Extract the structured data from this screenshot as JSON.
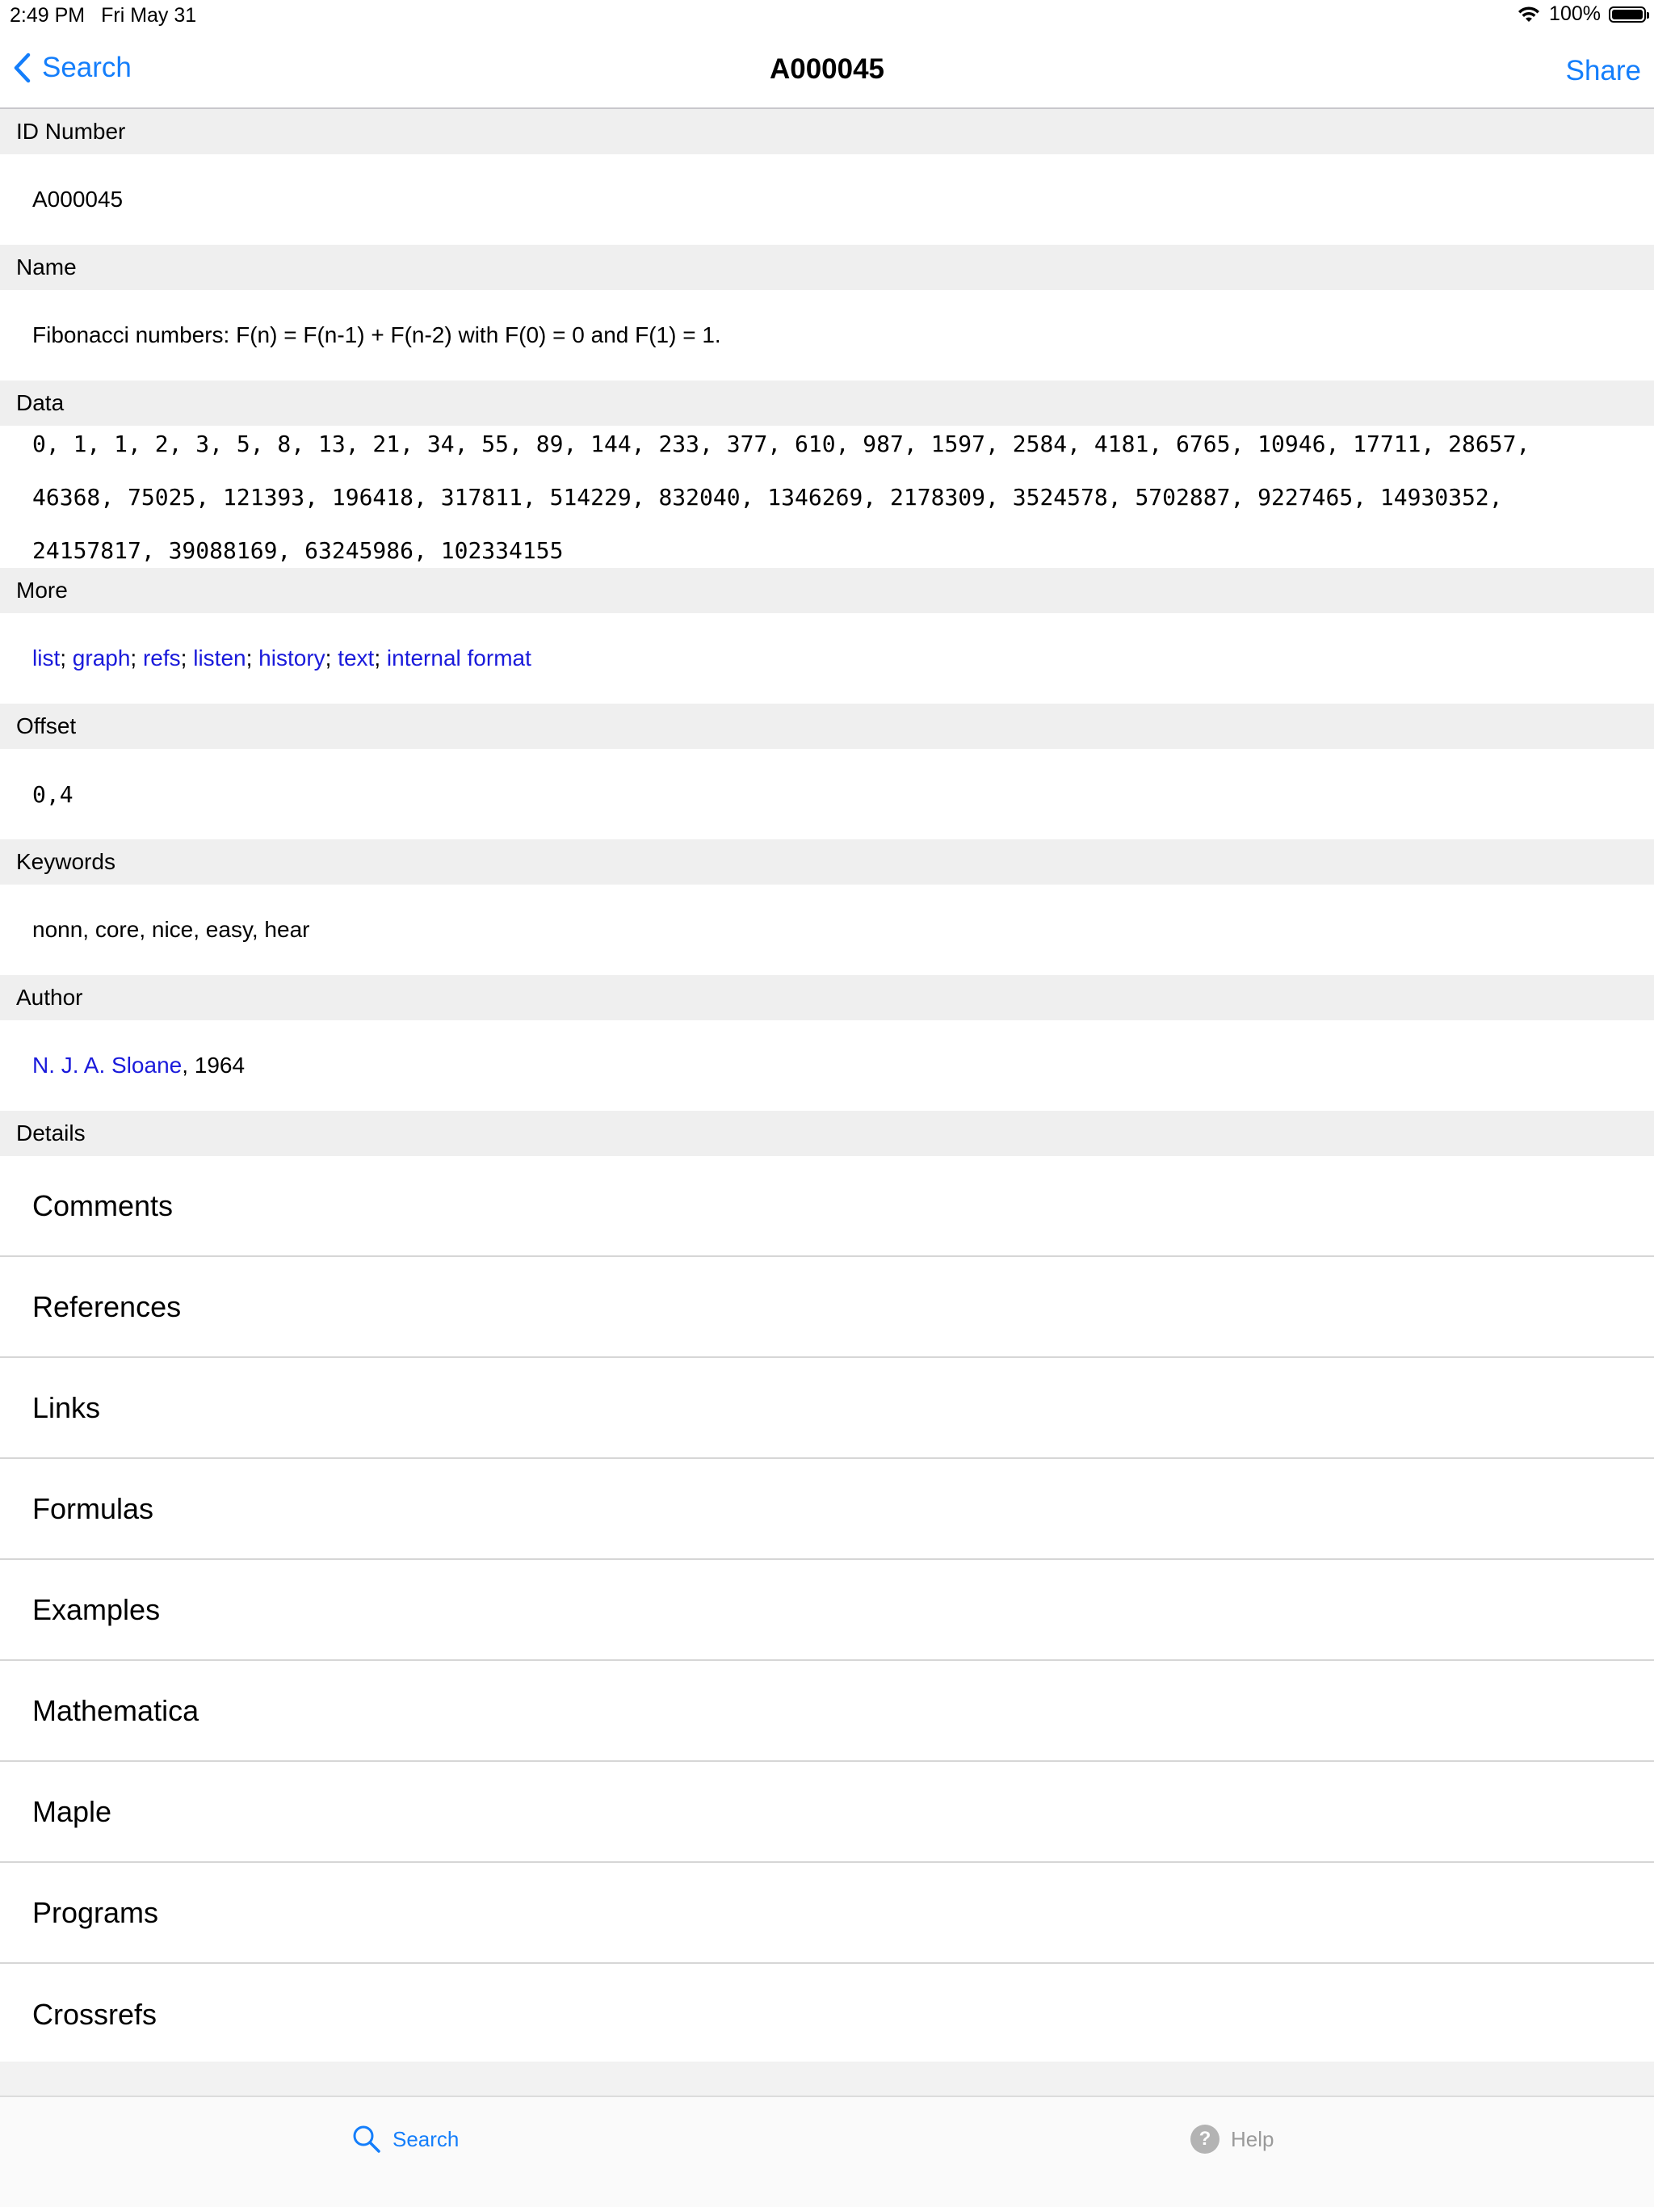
{
  "status_bar": {
    "time": "2:49 PM",
    "date": "Fri May 31",
    "battery": "100%"
  },
  "nav": {
    "back_label": "Search",
    "title": "A000045",
    "share_label": "Share"
  },
  "sections": {
    "id_number": {
      "header": "ID Number",
      "value": "A000045"
    },
    "name": {
      "header": "Name",
      "value": "Fibonacci numbers: F(n) = F(n-1) + F(n-2) with F(0) = 0 and F(1) = 1."
    },
    "data": {
      "header": "Data",
      "lines": [
        "0, 1, 1, 2, 3, 5, 8, 13, 21, 34, 55, 89, 144, 233, 377, 610, 987, 1597, 2584, 4181, 6765, 10946, 17711, 28657,",
        "46368, 75025, 121393, 196418, 317811, 514229, 832040, 1346269, 2178309, 3524578, 5702887, 9227465, 14930352,",
        "24157817, 39088169, 63245986, 102334155"
      ]
    },
    "more": {
      "header": "More",
      "links": [
        "list",
        "graph",
        "refs",
        "listen",
        "history",
        "text",
        "internal format"
      ],
      "separator": "; "
    },
    "offset": {
      "header": "Offset",
      "value": "0,4"
    },
    "keywords": {
      "header": "Keywords",
      "value": "nonn, core, nice, easy, hear"
    },
    "author": {
      "header": "Author",
      "link": "N. J. A. Sloane",
      "suffix": ", 1964"
    },
    "details": {
      "header": "Details",
      "items": [
        "Comments",
        "References",
        "Links",
        "Formulas",
        "Examples",
        "Mathematica",
        "Maple",
        "Programs",
        "Crossrefs"
      ]
    }
  },
  "tab_bar": {
    "search_label": "Search",
    "help_label": "Help",
    "help_glyph": "?"
  },
  "colors": {
    "accent": "#147efb",
    "link": "#1a1adb",
    "section_header_bg": "#efefef"
  }
}
